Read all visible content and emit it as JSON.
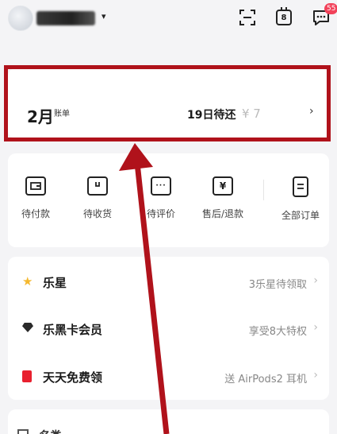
{
  "header": {
    "avatar_icon": "user-avatar",
    "caret": "▾",
    "icons": [
      "scan-icon",
      "calendar-icon",
      "message-icon"
    ],
    "calendar_day": "8",
    "message_badge": "55"
  },
  "bill": {
    "month": "2月",
    "label": "账单",
    "due": "19日待还",
    "amount": "¥   7",
    "chevron": "›"
  },
  "orders": [
    {
      "label": "待付款",
      "icon": "wallet-icon"
    },
    {
      "label": "待收货",
      "icon": "package-icon"
    },
    {
      "label": "待评价",
      "icon": "comment-icon"
    },
    {
      "label": "售后/退款",
      "icon": "refund-icon"
    },
    {
      "label": "全部订单",
      "icon": "order-list-icon"
    }
  ],
  "rows": [
    {
      "title": "乐星",
      "value": "3乐星待领取",
      "icon": "star-icon"
    },
    {
      "title": "乐黑卡会员",
      "value": "享受8大特权",
      "icon": "diamond-icon"
    },
    {
      "title": "天天免费领",
      "value": "送 AirPods2 耳机",
      "icon": "gift-icon"
    }
  ],
  "bottom": {
    "title": "·名类"
  },
  "colors": {
    "highlight": "#b0121b",
    "badge": "#f2425a",
    "star": "#f5b82e",
    "gift": "#e8202f"
  }
}
